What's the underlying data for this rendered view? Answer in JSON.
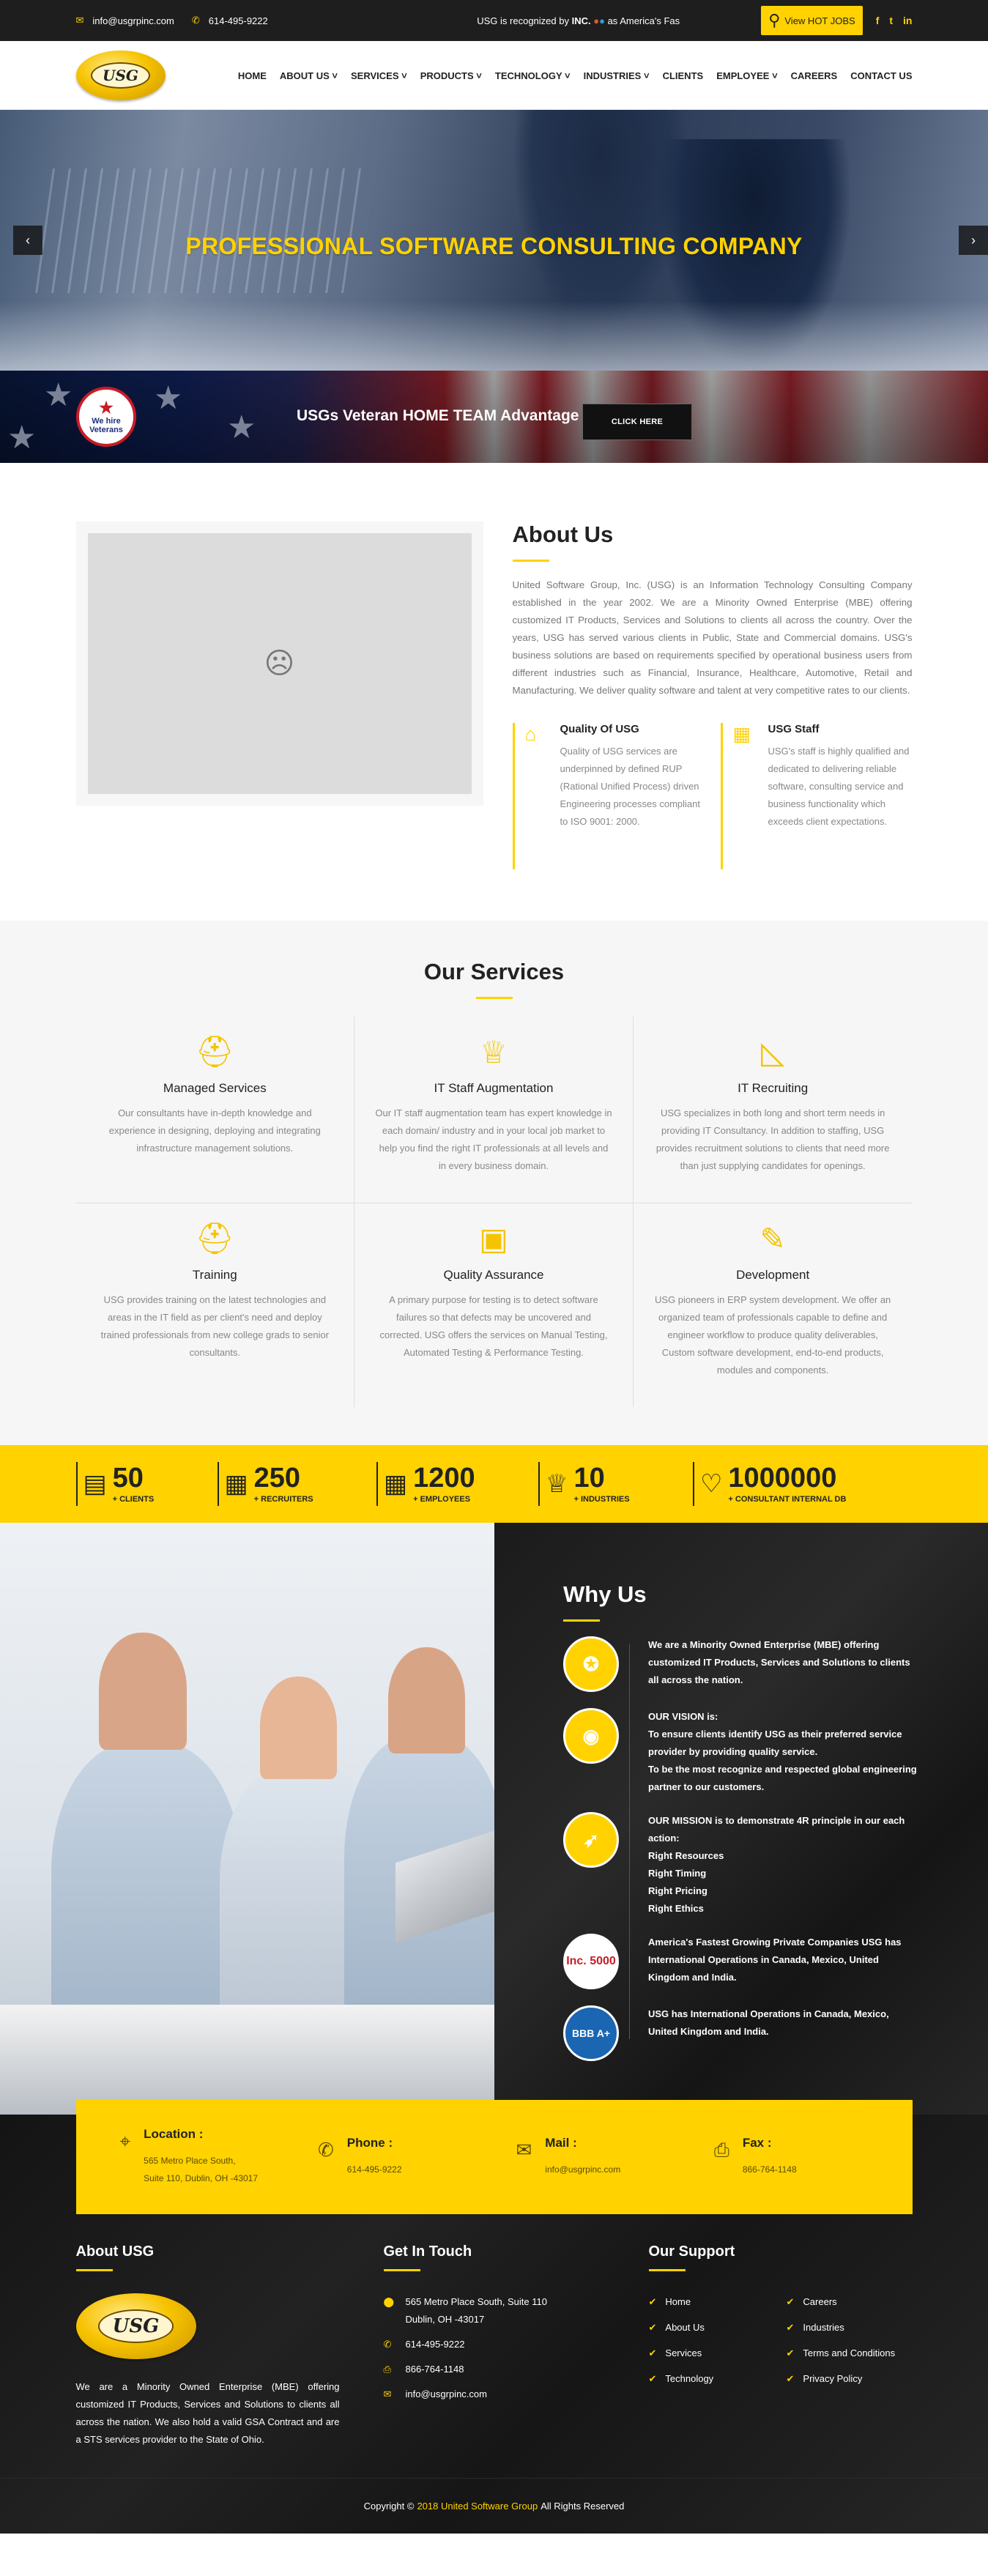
{
  "topbar": {
    "email": "info@usgrpinc.com",
    "phone": "614-495-9222",
    "marquee_pre": "USG is recognized by",
    "marquee_brand": "INC.",
    "marquee_post": "as America's Fas",
    "hot_jobs": "View HOT JOBS",
    "social": [
      "f",
      "t",
      "in"
    ]
  },
  "nav": {
    "logo_text": "USG",
    "items": [
      "HOME",
      "ABOUT US",
      "SERVICES",
      "PRODUCTS",
      "TECHNOLOGY",
      "INDUSTRIES",
      "CLIENTS",
      "EMPLOYEE",
      "CAREERS",
      "CONTACT US"
    ],
    "dropdown_marker": "˅"
  },
  "hero": {
    "title": "PROFESSIONAL SOFTWARE CONSULTING COMPANY",
    "prev": "‹",
    "next": "›"
  },
  "veteran": {
    "badge_line1": "We hire",
    "badge_line2": "Veterans",
    "title": "USGs Veteran HOME TEAM Advantage",
    "button": "CLICK HERE"
  },
  "about": {
    "heading": "About Us",
    "body": "United Software Group, Inc. (USG) is an Information Technology Consulting Company established in the year 2002. We are a Minority Owned Enterprise (MBE) offering customized IT Products, Services and Solutions to clients all across the country. Over the years, USG has served various clients in Public, State and Commercial domains. USG's business solutions are based on requirements specified by operational business users from different industries such as Financial, Insurance, Healthcare, Automotive, Retail and Manufacturing. We deliver quality software and talent at very competitive rates to our clients.",
    "cards": [
      {
        "title": "Quality Of USG",
        "text": "Quality of USG services are underpinned by defined RUP (Rational Unified Process) driven Engineering processes compliant to ISO 9001: 2000."
      },
      {
        "title": "USG Staff",
        "text": "USG's staff is highly qualified and dedicated to delivering reliable software, consulting service and business functionality which exceeds client expectations."
      }
    ]
  },
  "services": {
    "heading": "Our Services",
    "items": [
      {
        "title": "Managed Services",
        "text": "Our consultants have in-depth knowledge and experience in designing, deploying and integrating infrastructure management solutions."
      },
      {
        "title": "IT Staff Augmentation",
        "text": "Our IT staff augmentation team has expert knowledge in each domain/ industry and in your local job market to help you find the right IT professionals at all levels and in every business domain."
      },
      {
        "title": "IT Recruiting",
        "text": "USG specializes in both long and short term needs in providing IT Consultancy. In addition to staffing, USG provides recruitment solutions to clients that need more than just supplying candidates for openings."
      },
      {
        "title": "Training",
        "text": "USG provides training on the latest technologies and areas in the IT field as per client's need and deploy trained professionals from new college grads to senior consultants."
      },
      {
        "title": "Quality Assurance",
        "text": "A primary purpose for testing is to detect software failures so that defects may be uncovered and corrected. USG offers the services on Manual Testing, Automated Testing & Performance Testing."
      },
      {
        "title": "Development",
        "text": "USG pioneers in ERP system development. We offer an organized team of professionals capable to define and engineer workflow to produce quality deliverables, Custom software development, end-to-end products, modules and components."
      }
    ]
  },
  "counters": [
    {
      "num": "50",
      "label": "+ CLIENTS"
    },
    {
      "num": "250",
      "label": "+ RECRUITERS"
    },
    {
      "num": "1200",
      "label": "+ EMPLOYEES"
    },
    {
      "num": "10",
      "label": "+ INDUSTRIES"
    },
    {
      "num": "1000000",
      "label": "+ CONSULTANT INTERNAL DB"
    }
  ],
  "why": {
    "heading": "Why Us",
    "items": [
      {
        "text": "We are a Minority Owned Enterprise (MBE) offering customized IT Products, Services and Solutions to clients all across the nation."
      },
      {
        "text": "OUR VISION is:\nTo ensure clients identify USG as their preferred service provider by providing quality service.\nTo be the most recognize and respected global engineering partner to our customers."
      },
      {
        "text": "OUR MISSION is to demonstrate 4R principle in our each action:\nRight Resources\nRight Timing\nRight Pricing\nRight Ethics"
      },
      {
        "text": "America's Fastest Growing Private Companies USG has International Operations in Canada, Mexico, United Kingdom and India."
      },
      {
        "text": "USG has International Operations in Canada, Mexico, United Kingdom and India."
      }
    ],
    "badge_inc": "Inc. 5000",
    "badge_bbb": "BBB A+"
  },
  "contact": [
    {
      "title": "Location :",
      "text": "565 Metro Place South,\nSuite 110, Dublin, OH -43017"
    },
    {
      "title": "Phone :",
      "text": "614-495-9222"
    },
    {
      "title": "Mail :",
      "text": "info@usgrpinc.com"
    },
    {
      "title": "Fax :",
      "text": "866-764-1148"
    }
  ],
  "footer": {
    "about_title": "About USG",
    "about_text": "We are a Minority Owned Enterprise (MBE) offering customized IT Products, Services and Solutions to clients all across the nation. We also hold a valid GSA Contract and are a STS services provider to the State of Ohio.",
    "touch_title": "Get In Touch",
    "touch": [
      "565 Metro Place South, Suite 110\nDublin, OH -43017",
      "614-495-9222",
      "866-764-1148",
      "info@usgrpinc.com"
    ],
    "support_title": "Our Support",
    "support": [
      "Home",
      "Careers",
      "About Us",
      "Industries",
      "Services",
      "Terms and Conditions",
      "Technology",
      "Privacy Policy"
    ],
    "copy_pre": "Copyright ©",
    "copy_link": "2018 United Software Group",
    "copy_post": "All Rights Reserved"
  }
}
